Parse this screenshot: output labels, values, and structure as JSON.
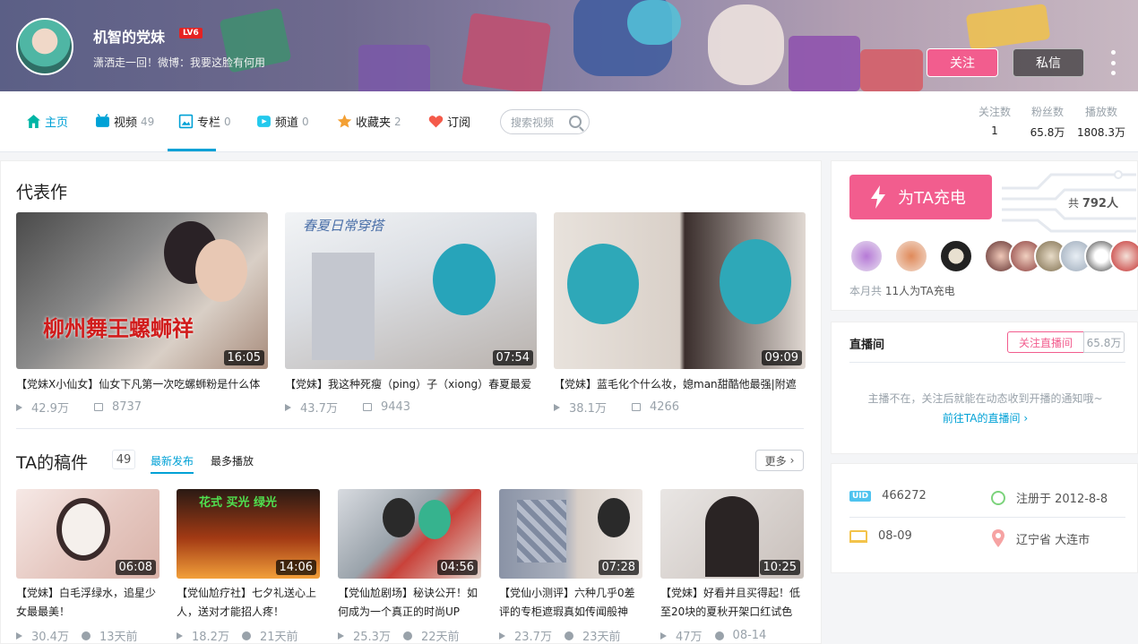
{
  "header": {
    "username": "机智的党妹",
    "level": "LV6",
    "signature": "潇洒走一回！微博：我要这脸有何用",
    "follow_label": "关注",
    "message_label": "私信"
  },
  "nav": {
    "items": [
      {
        "label": "主页",
        "count": "",
        "icon": "home-icon"
      },
      {
        "label": "视频",
        "count": "49",
        "icon": "video-icon"
      },
      {
        "label": "专栏",
        "count": "0",
        "icon": "article-icon"
      },
      {
        "label": "频道",
        "count": "0",
        "icon": "channel-icon"
      },
      {
        "label": "收藏夹",
        "count": "2",
        "icon": "star-icon"
      },
      {
        "label": "订阅",
        "count": "",
        "icon": "heart-icon"
      }
    ],
    "search_placeholder": "搜索视频",
    "stats": [
      {
        "label": "关注数",
        "value": "1"
      },
      {
        "label": "粉丝数",
        "value": "65.8万"
      },
      {
        "label": "播放数",
        "value": "1808.3万"
      }
    ]
  },
  "masterpiece": {
    "title": "代表作",
    "videos": [
      {
        "title": "【党妹X小仙女】仙女下凡第一次吃螺蛳粉是什么体",
        "duration": "16:05",
        "plays": "42.9万",
        "danmaku": "8737",
        "thumb_text": "柳州舞王螺蛳祥"
      },
      {
        "title": "【党妹】我这种死瘦（ping）子（xiong）春夏最爱",
        "duration": "07:54",
        "plays": "43.7万",
        "danmaku": "9443",
        "thumb_text": "春夏日常穿搭"
      },
      {
        "title": "【党妹】蓝毛化个什么妆，媳man甜酷他最强|附遮",
        "duration": "09:09",
        "plays": "38.1万",
        "danmaku": "4266",
        "thumb_text": ""
      }
    ]
  },
  "uploads": {
    "title": "TA的稿件",
    "count": "49",
    "tab_new": "最新发布",
    "tab_hot": "最多播放",
    "more_label": "更多",
    "videos": [
      {
        "title": "【党妹】白毛浮绿水，追星少女最最美！",
        "duration": "06:08",
        "plays": "30.4万",
        "time": "13天前"
      },
      {
        "title": "【党仙尬疗社】七夕礼送心上人，送对才能招人疼！",
        "duration": "14:06",
        "plays": "18.2万",
        "time": "21天前",
        "thumb_text": "花式 买光 绿光"
      },
      {
        "title": "【党仙尬剧场】秘诀公开！如何成为一个真正的时尚UP",
        "duration": "04:56",
        "plays": "25.3万",
        "time": "22天前"
      },
      {
        "title": "【党仙小测评】六种几乎0差评的专柜遮瑕真如传闻般神",
        "duration": "07:28",
        "plays": "23.7万",
        "time": "23天前"
      },
      {
        "title": "【党妹】好看并且买得起！低至20块的夏秋开架口红试色",
        "duration": "10:25",
        "plays": "47万",
        "time": "08-14"
      }
    ]
  },
  "charge": {
    "button_label": "为TA充电",
    "total_prefix": "共",
    "total_value": "792人",
    "note_prefix": "本月共",
    "note_count": "11人为TA充电"
  },
  "live": {
    "title": "直播间",
    "follow_label": "关注直播间",
    "follow_count": "65.8万",
    "message": "主播不在，关注后就能在动态收到开播的通知哦~",
    "link": "前往TA的直播间"
  },
  "info": {
    "uid_label": "UID",
    "uid": "466272",
    "register": "注册于 2012-8-8",
    "birthday": "08-09",
    "location": "辽宁省 大连市"
  },
  "colors": {
    "accent": "#00a1d6",
    "pink": "#f25d8e",
    "muted": "#99a2aa"
  }
}
